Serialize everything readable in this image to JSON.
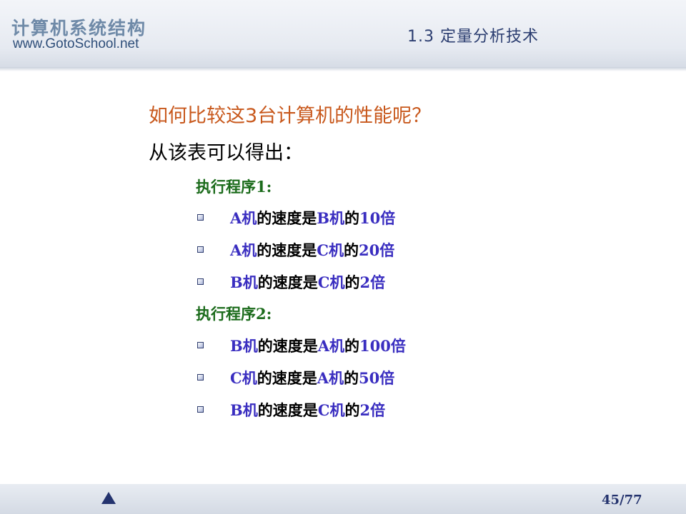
{
  "header": {
    "brand_title": "计算机系统结构",
    "brand_url": "www.GotoSchool.net",
    "section_title": "1.3 定量分析技术"
  },
  "content": {
    "question": "如何比较这3台计算机的性能呢？",
    "intro": "从该表可以得出：",
    "program1": {
      "heading": "执行程序1:",
      "items": [
        {
          "a": "A机",
          "mid": "的速度是",
          "b": "B机",
          "of": "的",
          "ratio": "10倍"
        },
        {
          "a": "A机",
          "mid": "的速度是",
          "b": "C机",
          "of": "的",
          "ratio": "20倍"
        },
        {
          "a": "B机",
          "mid": "的速度是",
          "b": "C机",
          "of": "的",
          "ratio": "2倍"
        }
      ]
    },
    "program2": {
      "heading": "执行程序2:",
      "items": [
        {
          "a": "B机",
          "mid": "的速度是",
          "b": "A机",
          "of": "的",
          "ratio": "100倍"
        },
        {
          "a": "C机",
          "mid": "的速度是",
          "b": "A机",
          "of": "的",
          "ratio": "50倍"
        },
        {
          "a": "B机",
          "mid": "的速度是",
          "b": "C机",
          "of": "的",
          "ratio": "2倍"
        }
      ]
    }
  },
  "footer": {
    "page_number": "45/77",
    "nav_icon": "triangle-up-icon"
  },
  "colors": {
    "question": "#c8581c",
    "program_heading": "#1b6b1b",
    "highlight": "#3a2ec0",
    "nav": "#24336e"
  }
}
